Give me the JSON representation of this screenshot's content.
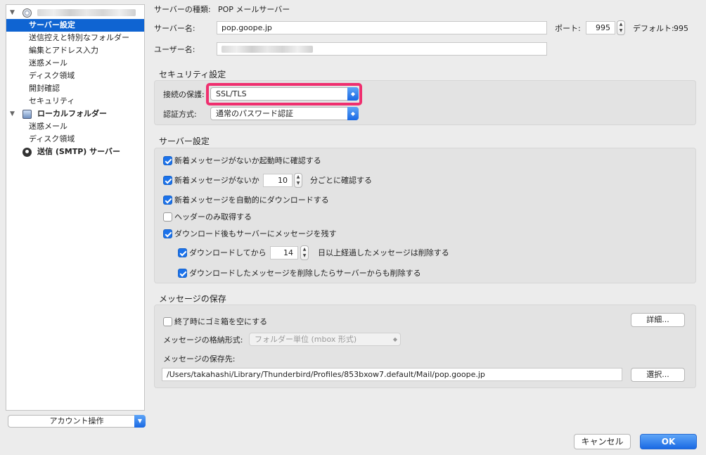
{
  "sidebar": {
    "server_settings": "サーバー設定",
    "copies_folders": "送信控えと特別なフォルダー",
    "composition": "編集とアドレス入力",
    "junk": "迷惑メール",
    "disk_space": "ディスク領域",
    "receipts": "開封確認",
    "security": "セキュリティ",
    "local_folders": "ローカルフォルダー",
    "local_junk": "迷惑メール",
    "local_disk_space": "ディスク領域",
    "smtp": "送信 (SMTP) サーバー",
    "account_actions": "アカウント操作"
  },
  "server": {
    "type_label": "サーバーの種類:",
    "type_value": "POP メールサーバー",
    "name_label": "サーバー名:",
    "name_value": "pop.goope.jp",
    "port_label": "ポート:",
    "port_value": "995",
    "default_label": "デフォルト:",
    "default_value": "995",
    "user_label": "ユーザー名:"
  },
  "security": {
    "title": "セキュリティ設定",
    "connection_label": "接続の保護:",
    "connection_value": "SSL/TLS",
    "auth_label": "認証方式:",
    "auth_value": "通常のパスワード認証"
  },
  "server_settings": {
    "title": "サーバー設定",
    "check_startup": "新着メッセージがないか起動時に確認する",
    "check_every_pre": "新着メッセージがないか",
    "check_every_value": "10",
    "check_every_post": "分ごとに確認する",
    "auto_download": "新着メッセージを自動的にダウンロードする",
    "headers_only": "ヘッダーのみ取得する",
    "leave_on_server": "ダウンロード後もサーバーにメッセージを残す",
    "delete_after_pre": "ダウンロードしてから",
    "delete_after_value": "14",
    "delete_after_post": "日以上経過したメッセージは削除する",
    "delete_from_server": "ダウンロードしたメッセージを削除したらサーバーからも削除する"
  },
  "message_storage": {
    "title": "メッセージの保存",
    "empty_trash": "終了時にゴミ箱を空にする",
    "details_button": "詳細...",
    "store_type_label": "メッセージの格納形式:",
    "store_type_value": "フォルダー単位 (mbox 形式)",
    "local_dir_label": "メッセージの保存先:",
    "local_dir_value": "/Users/takahashi/Library/Thunderbird/Profiles/853bxow7.default/Mail/pop.goope.jp",
    "browse_button": "選択..."
  },
  "footer": {
    "cancel": "キャンセル",
    "ok": "OK"
  },
  "colors": {
    "selection": "#0f64d2",
    "highlight": "#ef2f6f",
    "checkbox_on": "#1c72ea"
  }
}
